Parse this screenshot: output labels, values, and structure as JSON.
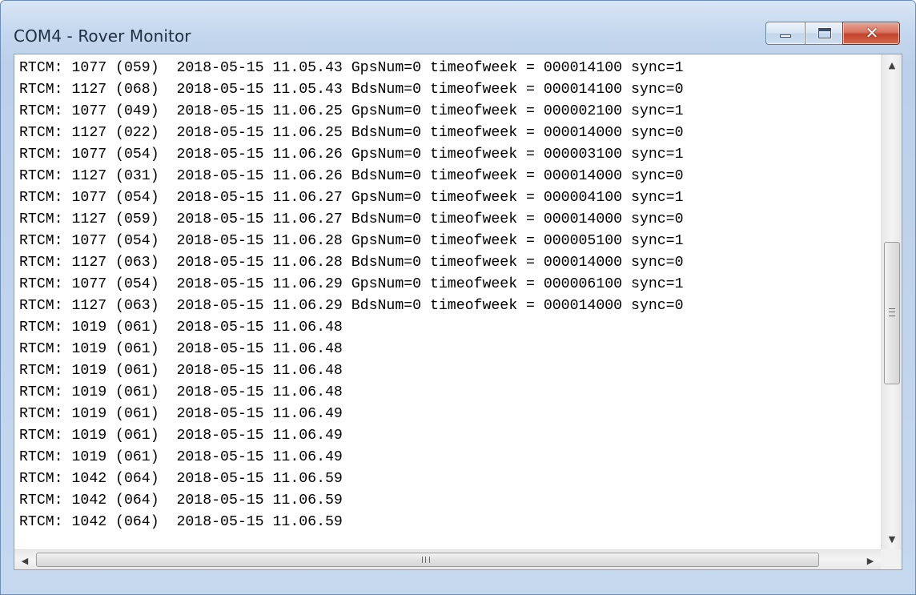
{
  "window": {
    "title": "COM4 - Rover Monitor"
  },
  "icons": {
    "minimize": "minimize-icon",
    "maximize": "maximize-icon",
    "close": "close-icon",
    "scroll_up": "arrow-up-icon",
    "scroll_down": "arrow-down-icon",
    "scroll_left": "arrow-left-icon",
    "scroll_right": "arrow-right-icon"
  },
  "colors": {
    "close_button": "#c4432b",
    "frame": "#c4d7ee"
  },
  "log": {
    "lines": [
      "RTCM: 1077 (059)  2018-05-15 11.05.43 GpsNum=0 timeofweek = 000014100 sync=1",
      "RTCM: 1127 (068)  2018-05-15 11.05.43 BdsNum=0 timeofweek = 000014100 sync=0",
      "RTCM: 1077 (049)  2018-05-15 11.06.25 GpsNum=0 timeofweek = 000002100 sync=1",
      "RTCM: 1127 (022)  2018-05-15 11.06.25 BdsNum=0 timeofweek = 000014000 sync=0",
      "RTCM: 1077 (054)  2018-05-15 11.06.26 GpsNum=0 timeofweek = 000003100 sync=1",
      "RTCM: 1127 (031)  2018-05-15 11.06.26 BdsNum=0 timeofweek = 000014000 sync=0",
      "RTCM: 1077 (054)  2018-05-15 11.06.27 GpsNum=0 timeofweek = 000004100 sync=1",
      "RTCM: 1127 (059)  2018-05-15 11.06.27 BdsNum=0 timeofweek = 000014000 sync=0",
      "RTCM: 1077 (054)  2018-05-15 11.06.28 GpsNum=0 timeofweek = 000005100 sync=1",
      "RTCM: 1127 (063)  2018-05-15 11.06.28 BdsNum=0 timeofweek = 000014000 sync=0",
      "RTCM: 1077 (054)  2018-05-15 11.06.29 GpsNum=0 timeofweek = 000006100 sync=1",
      "RTCM: 1127 (063)  2018-05-15 11.06.29 BdsNum=0 timeofweek = 000014000 sync=0",
      "RTCM: 1019 (061)  2018-05-15 11.06.48",
      "RTCM: 1019 (061)  2018-05-15 11.06.48",
      "RTCM: 1019 (061)  2018-05-15 11.06.48",
      "RTCM: 1019 (061)  2018-05-15 11.06.48",
      "RTCM: 1019 (061)  2018-05-15 11.06.49",
      "RTCM: 1019 (061)  2018-05-15 11.06.49",
      "RTCM: 1019 (061)  2018-05-15 11.06.49",
      "RTCM: 1042 (064)  2018-05-15 11.06.59",
      "RTCM: 1042 (064)  2018-05-15 11.06.59",
      "RTCM: 1042 (064)  2018-05-15 11.06.59"
    ]
  },
  "scrollbars": {
    "vertical_grip": "≡",
    "horizontal_grip": "III"
  }
}
